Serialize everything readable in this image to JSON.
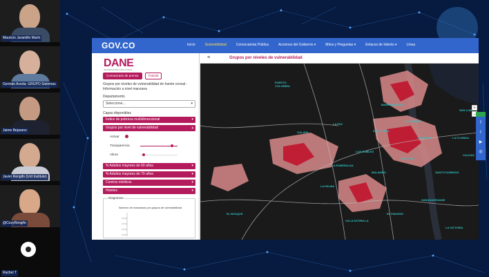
{
  "participants": [
    {
      "name": "Mauricio Jaramillo Marín"
    },
    {
      "name": "Germán Aceda- GRUPO Sistemas"
    },
    {
      "name": "Jaime Bejarano"
    },
    {
      "name": "Javier Rengifo (Urd Institute)"
    },
    {
      "name": "@CozyRengifo"
    },
    {
      "name": "Rachel T"
    }
  ],
  "gov_bar": {
    "logo": "GOV.CO",
    "nav": [
      {
        "label": "Inicio",
        "active": false
      },
      {
        "label": "Sostenibilidad",
        "active": true
      },
      {
        "label": "Convocatoria Pública",
        "active": false
      },
      {
        "label": "Acciones del Gobierno ▾",
        "active": false
      },
      {
        "label": "Mitos y Preguntas ▾",
        "active": false
      },
      {
        "label": "Enlaces de Interés ▾",
        "active": false
      },
      {
        "label": "Línea",
        "active": false
      }
    ]
  },
  "panel": {
    "logo": "DANE",
    "logo_sub": "INFORMACIÓN PARA TODOS",
    "btn_comunicado": "Comunicado de prensa",
    "btn_tutorial": "Tutorial",
    "description": "Grupos por niveles de vulnerabilidad de fuente censal - Información a nivel manzana",
    "department_label": "Departamento",
    "department_value": "Seleccione...",
    "layers_label": "Capas disponibles",
    "layers": [
      {
        "label": "Índice de pobreza multidimensional"
      },
      {
        "label": "Grupos por nivel de vulnerabilidad"
      },
      {
        "label": "% Adultos mayores de 60 años"
      },
      {
        "label": "% Adultos mayores de 70 años"
      },
      {
        "label": "Centros médicos"
      },
      {
        "label": "Hoteles"
      }
    ],
    "controls": {
      "activar": "Activar",
      "transparencia": "Transparencia",
      "altura": "Altura",
      "transparencia_level": 0.85,
      "altura_level": 0.1
    },
    "diagram_label": "Diagramas",
    "diagram_caption": "Número de manzanas por grupos de vulnerabilidad"
  },
  "map": {
    "title": "Grupos por niveles de vulnerabilidad",
    "zoom_in": "+",
    "zoom_out": "−",
    "places": [
      {
        "label": "PUERTO\nCOLOMBIA"
      },
      {
        "label": "GALAPA"
      },
      {
        "label": "BARRANQUILLA"
      },
      {
        "label": "MALAMBO"
      },
      {
        "label": "SOLEDAD"
      },
      {
        "label": "SABANAGRANDE"
      },
      {
        "label": "LOS ROBLES"
      },
      {
        "label": "LA ESMERALDA"
      },
      {
        "label": "SANTO DOMINGO"
      },
      {
        "label": "SAN JOSÉ"
      },
      {
        "label": "CALDAS"
      },
      {
        "label": "LA FLORIDA"
      },
      {
        "label": "VILLA ESTRELLA"
      },
      {
        "label": "EL PARAÍSO"
      },
      {
        "label": "LA VICTORIA"
      },
      {
        "label": "LA PALMA"
      },
      {
        "label": "SANTA RITA"
      },
      {
        "label": "LAS NIEVES"
      },
      {
        "label": "EL BOSQUE"
      },
      {
        "label": "LA PAZ"
      },
      {
        "label": "SAN LUIS"
      }
    ]
  },
  "social": [
    "f",
    "t",
    "▶",
    "◎"
  ]
}
